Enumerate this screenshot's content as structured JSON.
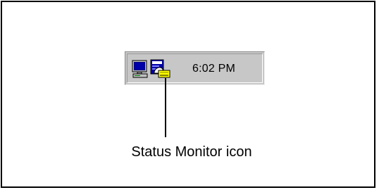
{
  "taskbar_tray": {
    "clock_time": "6:02 PM",
    "icons": [
      "computer-monitor-icon",
      "status-monitor-icon"
    ]
  },
  "callout": {
    "label": "Status Monitor icon"
  }
}
